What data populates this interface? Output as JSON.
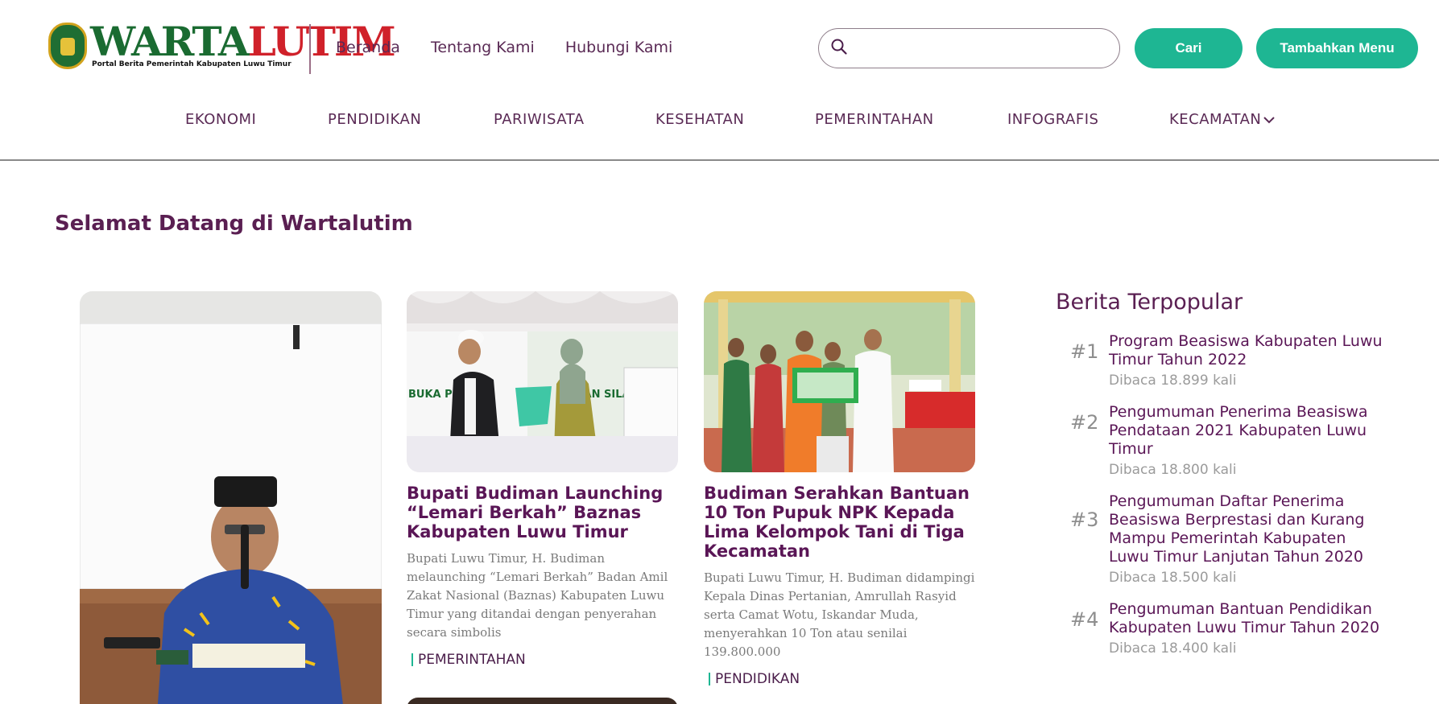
{
  "brand": {
    "name_part1": "WARTA",
    "name_part2": "LUTIM",
    "tagline": "Portal Berita Pemerintah Kabupaten Luwu Timur",
    "emblem_text": "LUWU TIMUR"
  },
  "topnav": [
    {
      "label": "Beranda"
    },
    {
      "label": "Tentang Kami"
    },
    {
      "label": "Hubungi Kami"
    }
  ],
  "search": {
    "placeholder": "",
    "value": "",
    "button_label": "Cari"
  },
  "add_menu_label": "Tambahkan Menu",
  "categories": [
    {
      "label": "EKONOMI"
    },
    {
      "label": "PENDIDIKAN"
    },
    {
      "label": "PARIWISATA"
    },
    {
      "label": "KESEHATAN"
    },
    {
      "label": "PEMERINTAHAN"
    },
    {
      "label": "INFOGRAFIS"
    },
    {
      "label": "KECAMATAN"
    }
  ],
  "welcome": "Selamat Datang di Wartalutim",
  "articles": [
    {
      "title": "Bupati Budiman Launching “Lemari Berkah” Baznas Kabupaten Luwu Timur",
      "excerpt": "Bupati Luwu Timur, H. Budiman melaunching “Lemari Berkah” Badan Amil Zakat Nasional (Baznas) Kabupaten Luwu Timur yang ditandai dengan penyerahan secara simbolis",
      "category": "PEMERINTAHAN"
    },
    {
      "title": "Budiman Serahkan Bantuan 10 Ton Pupuk NPK Kepada Lima Kelompok Tani di Tiga Kecamatan",
      "excerpt": "Bupati Luwu Timur, H. Budiman didampingi Kepala Dinas Pertanian, Amrullah Rasyid serta Camat Wotu, Iskandar Muda, menyerahkan 10 Ton atau senilai 139.800.000",
      "category": "PENDIDIKAN"
    }
  ],
  "popular": {
    "heading": "Berita Terpopular",
    "items": [
      {
        "rank": "#1",
        "title": "Program Beasiswa Kabupaten Luwu Timur Tahun 2022",
        "reads": "Dibaca 18.899 kali"
      },
      {
        "rank": "#2",
        "title": "Pengumuman Penerima Beasiswa Pendataan 2021 Kabupaten Luwu Timur",
        "reads": "Dibaca 18.800 kali"
      },
      {
        "rank": "#3",
        "title": "Pengumuman Daftar Penerima Beasiswa Berprestasi dan Kurang Mampu Pemerintah Kabupaten Luwu Timur Lanjutan Tahun 2020",
        "reads": "Dibaca 18.500 kali"
      },
      {
        "rank": "#4",
        "title": "Pengumuman Bantuan Pendidikan Kabupaten Luwu Timur Tahun 2020",
        "reads": "Dibaca 18.400 kali"
      }
    ]
  },
  "colors": {
    "accent": "#1eb693",
    "brand_purple": "#5a1656",
    "logo_green": "#1a6b31",
    "logo_red": "#d0212a"
  }
}
